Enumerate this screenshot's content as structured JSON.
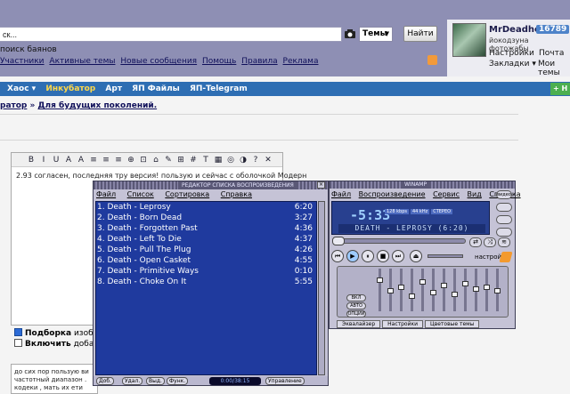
{
  "header": {
    "search_value": "ск...",
    "themes_label": "Темы",
    "find_label": "Найти",
    "search_hint": "поиск баянов",
    "nav_links": [
      "Участники",
      "Активные темы",
      "Новые сообщения",
      "Помощь",
      "Правила",
      "Реклама"
    ]
  },
  "user": {
    "name": "MrDeadhead",
    "count": "16789",
    "subtitle": "йокодзуна фотожабы",
    "settings": "Настройки",
    "mail": "Почта",
    "bookmarks": "Закладки",
    "my_themes": "Мои темы"
  },
  "catbar": {
    "items": [
      "Хаос",
      "Инкубатор",
      "Арт",
      "ЯП Файлы",
      "ЯП-Telegram"
    ],
    "new_label": "Н"
  },
  "crumb": {
    "prefix": "ратор",
    "sep": "»",
    "link": "Для будущих поколений."
  },
  "editor": {
    "toolbar": [
      "B",
      "I",
      "U",
      "A",
      "A",
      "≡",
      "≡",
      "≡",
      "⊕",
      "⊡",
      "⌂",
      "✎",
      "⊞",
      "#",
      "T",
      "▦",
      "◎",
      "◑",
      "?",
      "✕"
    ],
    "text": "2.93 согласен, последняя тру версия! пользую и сейчас с оболочкой Модерн"
  },
  "options": {
    "opt1_bold": "Подборка",
    "opt1_rest": "изображ",
    "opt2_bold": "Включить",
    "opt2_rest": "добавле"
  },
  "reply_text": [
    "до сих пор пользую ви",
    "частотный диапазон .",
    "кодеки , мать их ети"
  ],
  "playlist": {
    "title": "РЕДАКТОР СПИСКА ВОСПРОИЗВЕДЕНИЯ",
    "menu": [
      "Файл",
      "Список",
      "Сортировка",
      "Справка"
    ],
    "tracks": [
      {
        "name": "1. Death - Leprosy",
        "duration": "6:20"
      },
      {
        "name": "2. Death - Born Dead",
        "duration": "3:27"
      },
      {
        "name": "3. Death - Forgotten Past",
        "duration": "4:36"
      },
      {
        "name": "4. Death - Left To Die",
        "duration": "4:37"
      },
      {
        "name": "5. Death - Pull The Plug",
        "duration": "4:26"
      },
      {
        "name": "6. Death - Open Casket",
        "duration": "4:55"
      },
      {
        "name": "7. Death - Primitive Ways",
        "duration": "0:10"
      },
      {
        "name": "8. Death - Choke On It",
        "duration": "5:55"
      }
    ],
    "bottom_buttons": [
      "Доб.",
      "Удал.",
      "Выд.",
      "Функ.",
      "Управление"
    ],
    "time_readout": "0:00/38:15"
  },
  "winamp": {
    "title": "WINAMP",
    "menu": [
      "Файл",
      "Воспроизведение",
      "Сервис",
      "Вид",
      "Справка"
    ],
    "time": "-5:33",
    "badges": [
      "128 kbps",
      "44 kHz",
      "СТЕРЕО"
    ],
    "marquee": "DEATH - LEPROSY (6:20)",
    "side": [
      "видео",
      "",
      "",
      "",
      ""
    ],
    "eq_buttons": [
      "ВКЛ",
      "АВТО",
      "ОПЦИИ"
    ],
    "settings_label": "настройки",
    "tabs": [
      "Эквалайзер",
      "Настройки",
      "Цветовые темы"
    ]
  },
  "colors": {
    "header_bg": "#8e8fb4",
    "catbar_bg": "#2e6eb3",
    "playlist_bg": "#1f3a9e",
    "accent_yellow": "#ffd84a"
  }
}
